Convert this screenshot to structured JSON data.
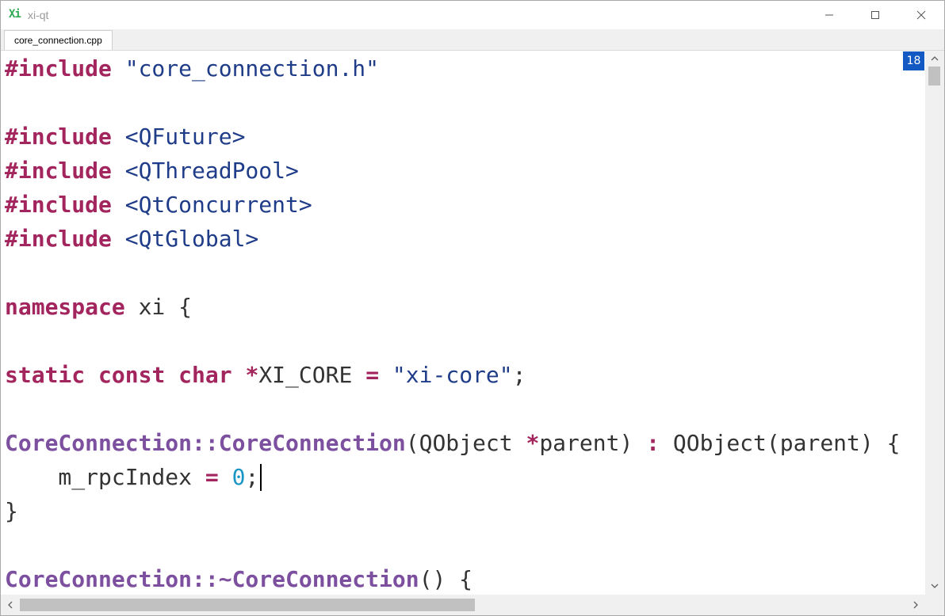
{
  "window": {
    "icon_text": "Xi",
    "title": "xi-qt"
  },
  "tabs": [
    {
      "label": "core_connection.cpp",
      "active": true
    }
  ],
  "editor": {
    "line_badge": "18",
    "lines": [
      {
        "t1": "#include",
        "t2": " ",
        "t3": "\"core_connection.h\""
      },
      {},
      {
        "t1": "#include",
        "t2": " ",
        "t3": "<QFuture>"
      },
      {
        "t1": "#include",
        "t2": " ",
        "t3": "<QThreadPool>"
      },
      {
        "t1": "#include",
        "t2": " ",
        "t3": "<QtConcurrent>"
      },
      {
        "t1": "#include",
        "t2": " ",
        "t3": "<QtGlobal>"
      },
      {},
      {
        "t1": "namespace",
        "t2": " xi {"
      },
      {},
      {
        "t1": "static",
        "t2": " ",
        "t3": "const",
        "t4": " ",
        "t5": "char",
        "t6": " ",
        "t7": "*",
        "t8": "XI_CORE ",
        "t9": "=",
        "t10": " ",
        "t11": "\"xi-core\"",
        "t12": ";"
      },
      {},
      {
        "t1": "CoreConnection::CoreConnection",
        "t2": "(QObject ",
        "t3": "*",
        "t4": "parent) ",
        "t5": ":",
        "t6": " QObject(parent) {"
      },
      {
        "t1": "    m_rpcIndex ",
        "t2": "=",
        "t3": " ",
        "t4": "0",
        "t5": ";"
      },
      {
        "t1": "}"
      },
      {},
      {
        "t1": "CoreConnection::~CoreConnection",
        "t2": "() {"
      }
    ]
  },
  "colors": {
    "keyword": "#a3255d",
    "string": "#1f3c88",
    "function": "#7c4f9f",
    "number": "#1a96c5",
    "badge": "#1259c3",
    "app_icon": "#2eaa55"
  }
}
